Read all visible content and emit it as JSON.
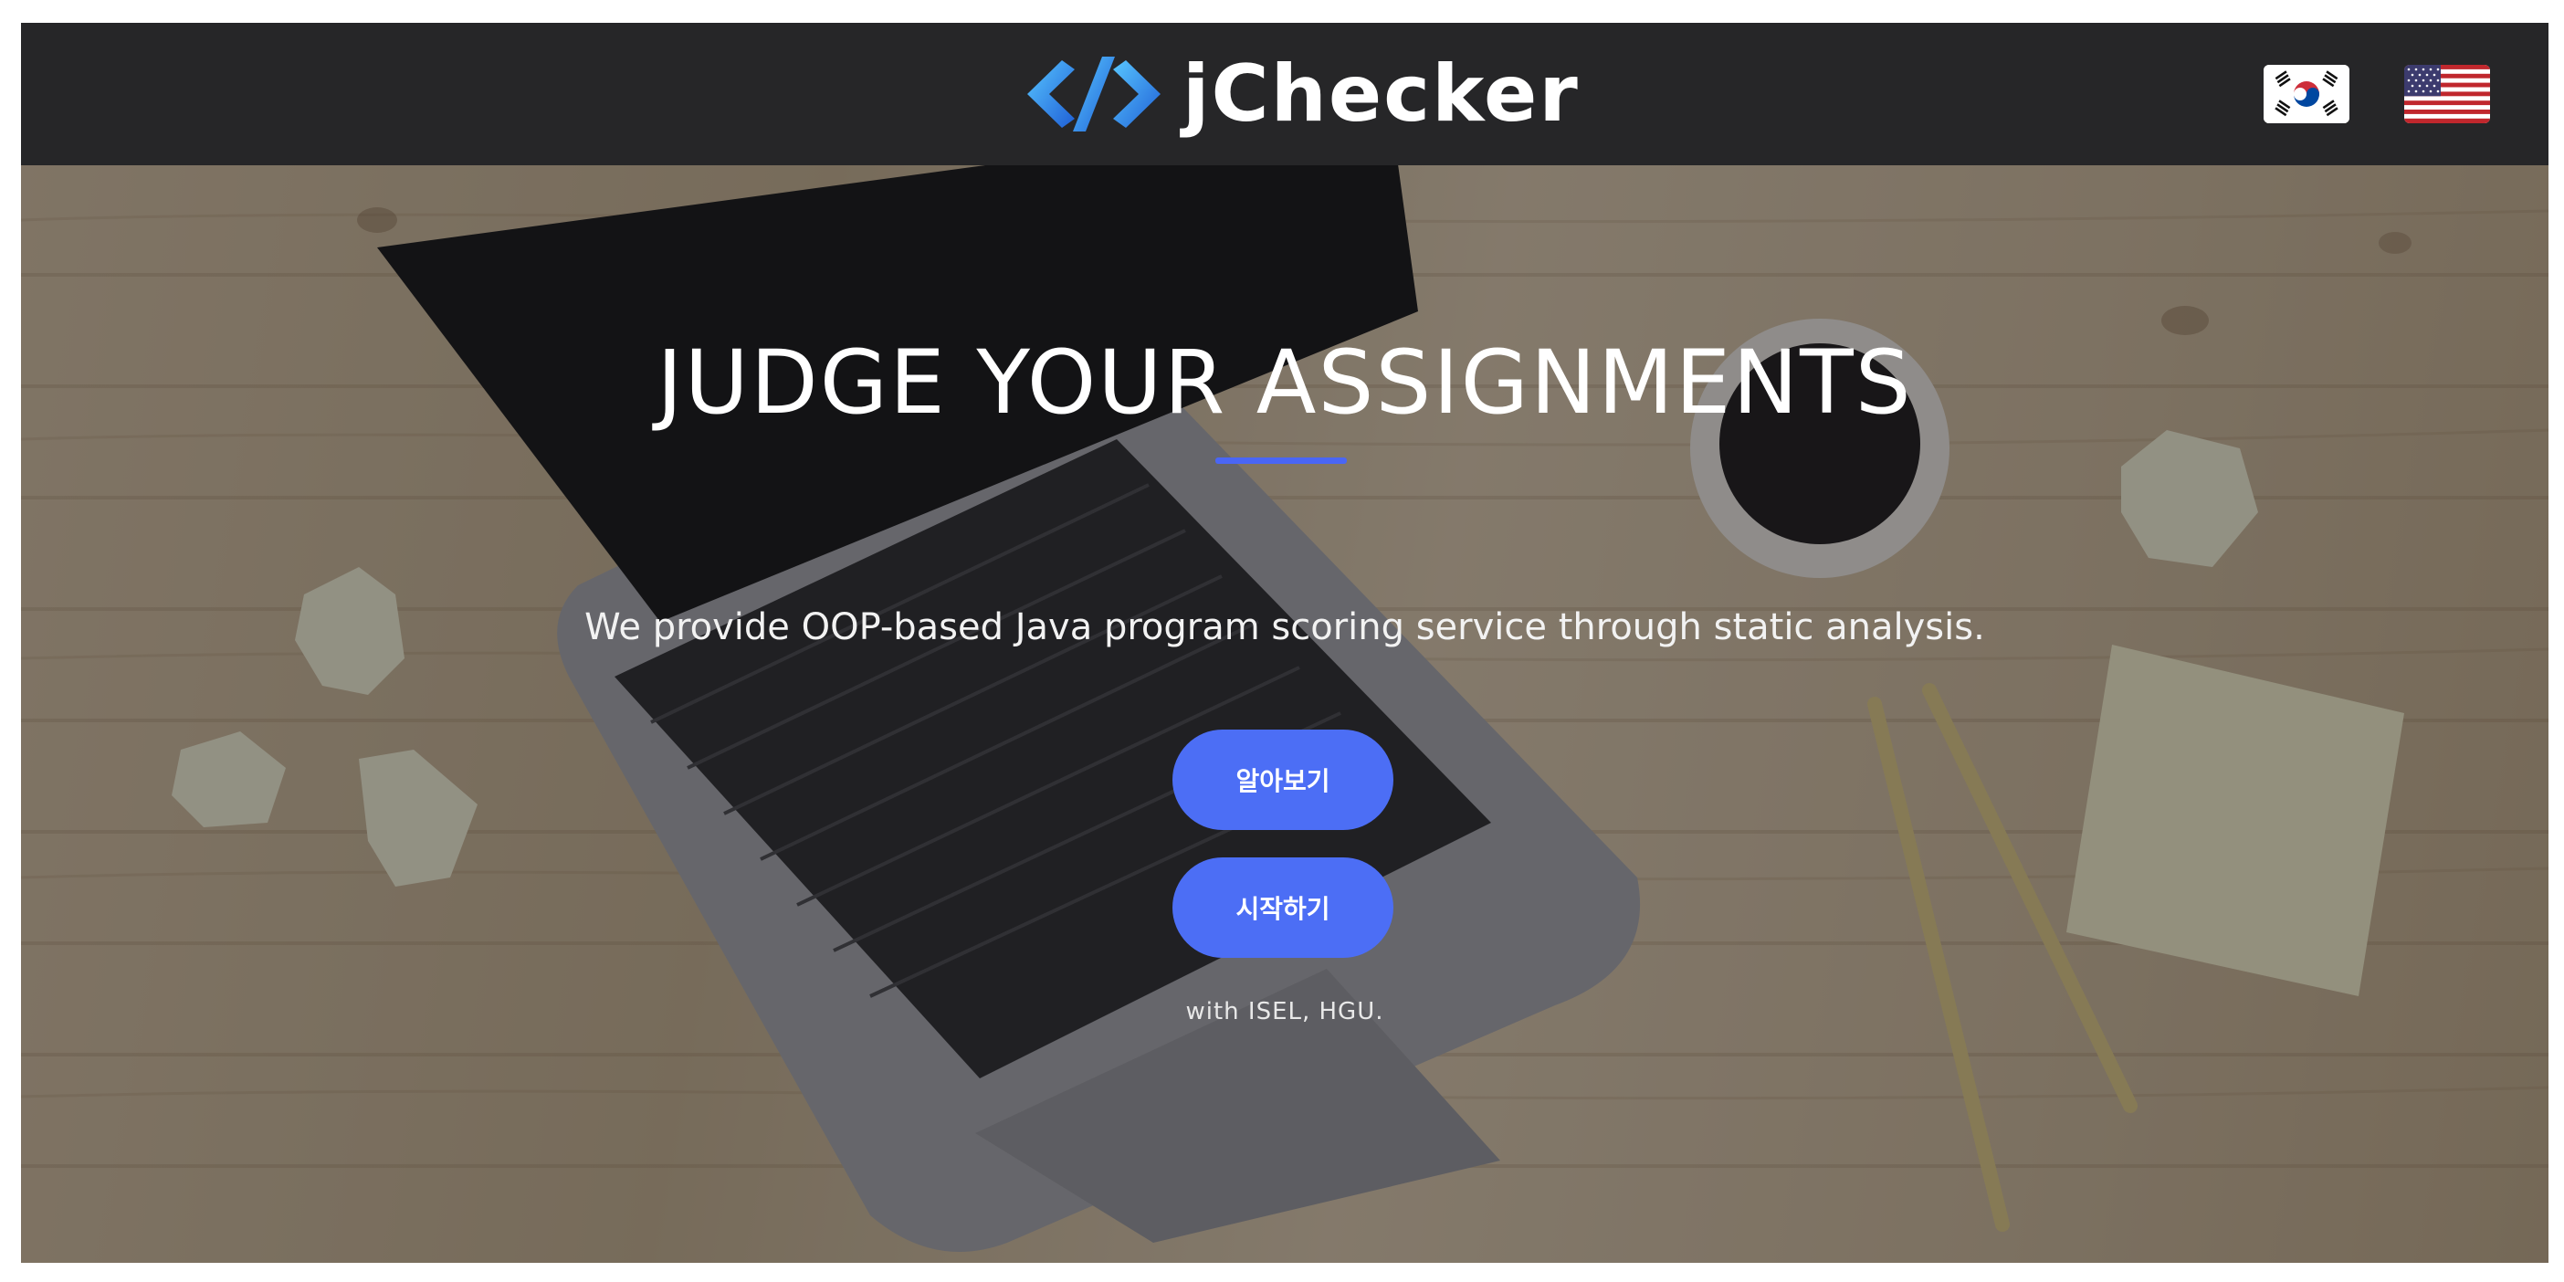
{
  "header": {
    "brand_name": "jChecker",
    "logo_icon": "code-brackets-icon",
    "languages": [
      {
        "code": "ko",
        "icon": "korea-flag-icon"
      },
      {
        "code": "en",
        "icon": "usa-flag-icon"
      }
    ]
  },
  "hero": {
    "headline": "JUDGE YOUR ASSIGNMENTS",
    "tagline": "We provide OOP-based Java program scoring service through static analysis.",
    "learn_more_label": "알아보기",
    "start_label": "시작하기",
    "credit": "with ISEL, HGU."
  },
  "colors": {
    "navbar_bg": "#262628",
    "accent": "#4c6ef5",
    "underline": "#4a66f5",
    "text": "#ffffff"
  }
}
